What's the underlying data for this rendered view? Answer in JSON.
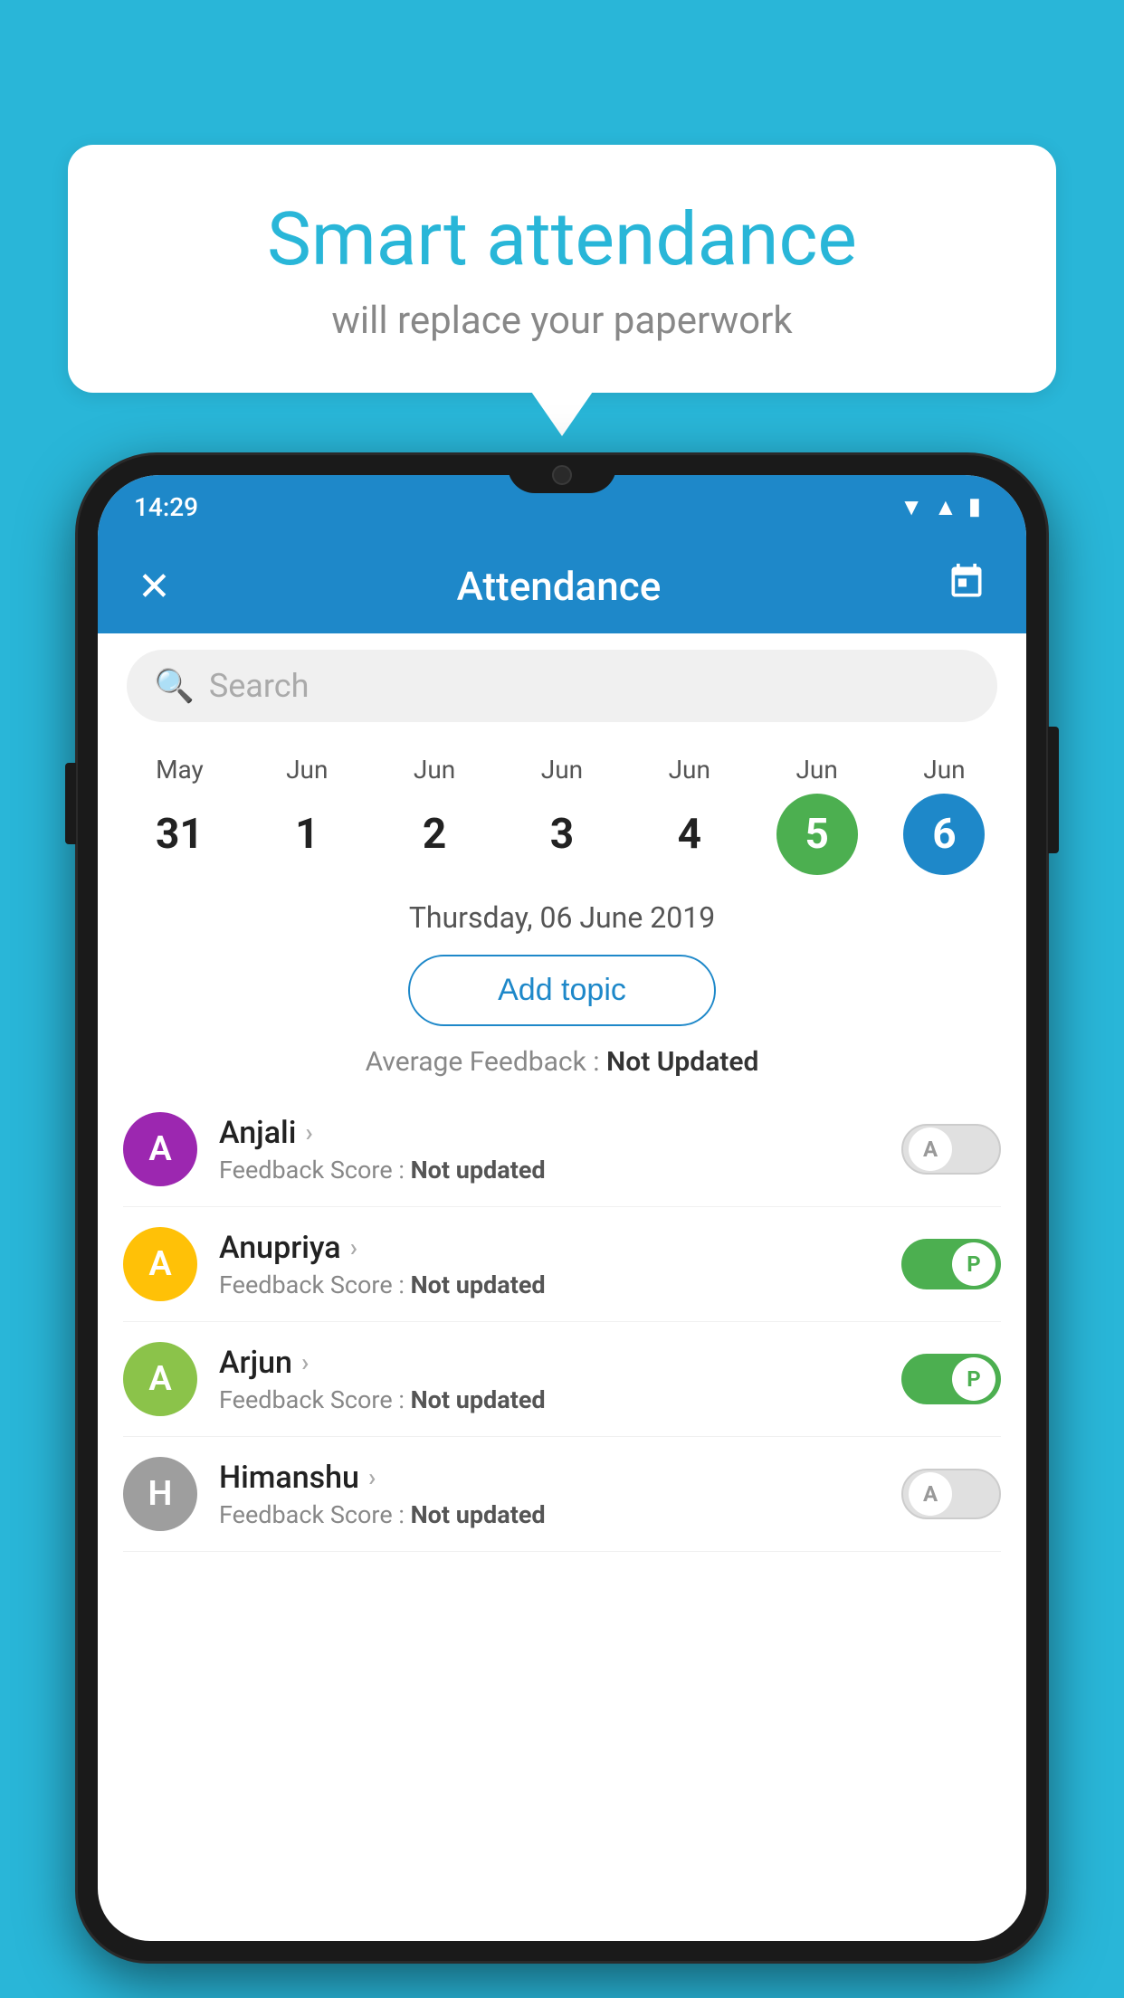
{
  "background_color": "#29b6d8",
  "speech_bubble": {
    "title": "Smart attendance",
    "subtitle": "will replace your paperwork"
  },
  "status_bar": {
    "time": "14:29",
    "wifi": "▼",
    "signal": "▲",
    "battery": "▮"
  },
  "header": {
    "title": "Attendance",
    "close_label": "✕",
    "calendar_label": "📅"
  },
  "search": {
    "placeholder": "Search"
  },
  "calendar": {
    "days": [
      {
        "month": "May",
        "date": "31",
        "state": "normal"
      },
      {
        "month": "Jun",
        "date": "1",
        "state": "normal"
      },
      {
        "month": "Jun",
        "date": "2",
        "state": "normal"
      },
      {
        "month": "Jun",
        "date": "3",
        "state": "normal"
      },
      {
        "month": "Jun",
        "date": "4",
        "state": "normal"
      },
      {
        "month": "Jun",
        "date": "5",
        "state": "today"
      },
      {
        "month": "Jun",
        "date": "6",
        "state": "selected"
      }
    ],
    "selected_date_label": "Thursday, 06 June 2019"
  },
  "add_topic_label": "Add topic",
  "average_feedback": {
    "label": "Average Feedback : ",
    "value": "Not Updated"
  },
  "students": [
    {
      "name": "Anjali",
      "feedback_label": "Feedback Score : ",
      "feedback_value": "Not updated",
      "avatar_letter": "A",
      "avatar_color": "#9c27b0",
      "toggle_state": "off",
      "toggle_letter": "A"
    },
    {
      "name": "Anupriya",
      "feedback_label": "Feedback Score : ",
      "feedback_value": "Not updated",
      "avatar_letter": "A",
      "avatar_color": "#ffc107",
      "toggle_state": "on",
      "toggle_letter": "P"
    },
    {
      "name": "Arjun",
      "feedback_label": "Feedback Score : ",
      "feedback_value": "Not updated",
      "avatar_letter": "A",
      "avatar_color": "#8bc34a",
      "toggle_state": "on",
      "toggle_letter": "P"
    },
    {
      "name": "Himanshu",
      "feedback_label": "Feedback Score : ",
      "feedback_value": "Not updated",
      "avatar_letter": "H",
      "avatar_color": "#9e9e9e",
      "toggle_state": "off",
      "toggle_letter": "A"
    }
  ]
}
